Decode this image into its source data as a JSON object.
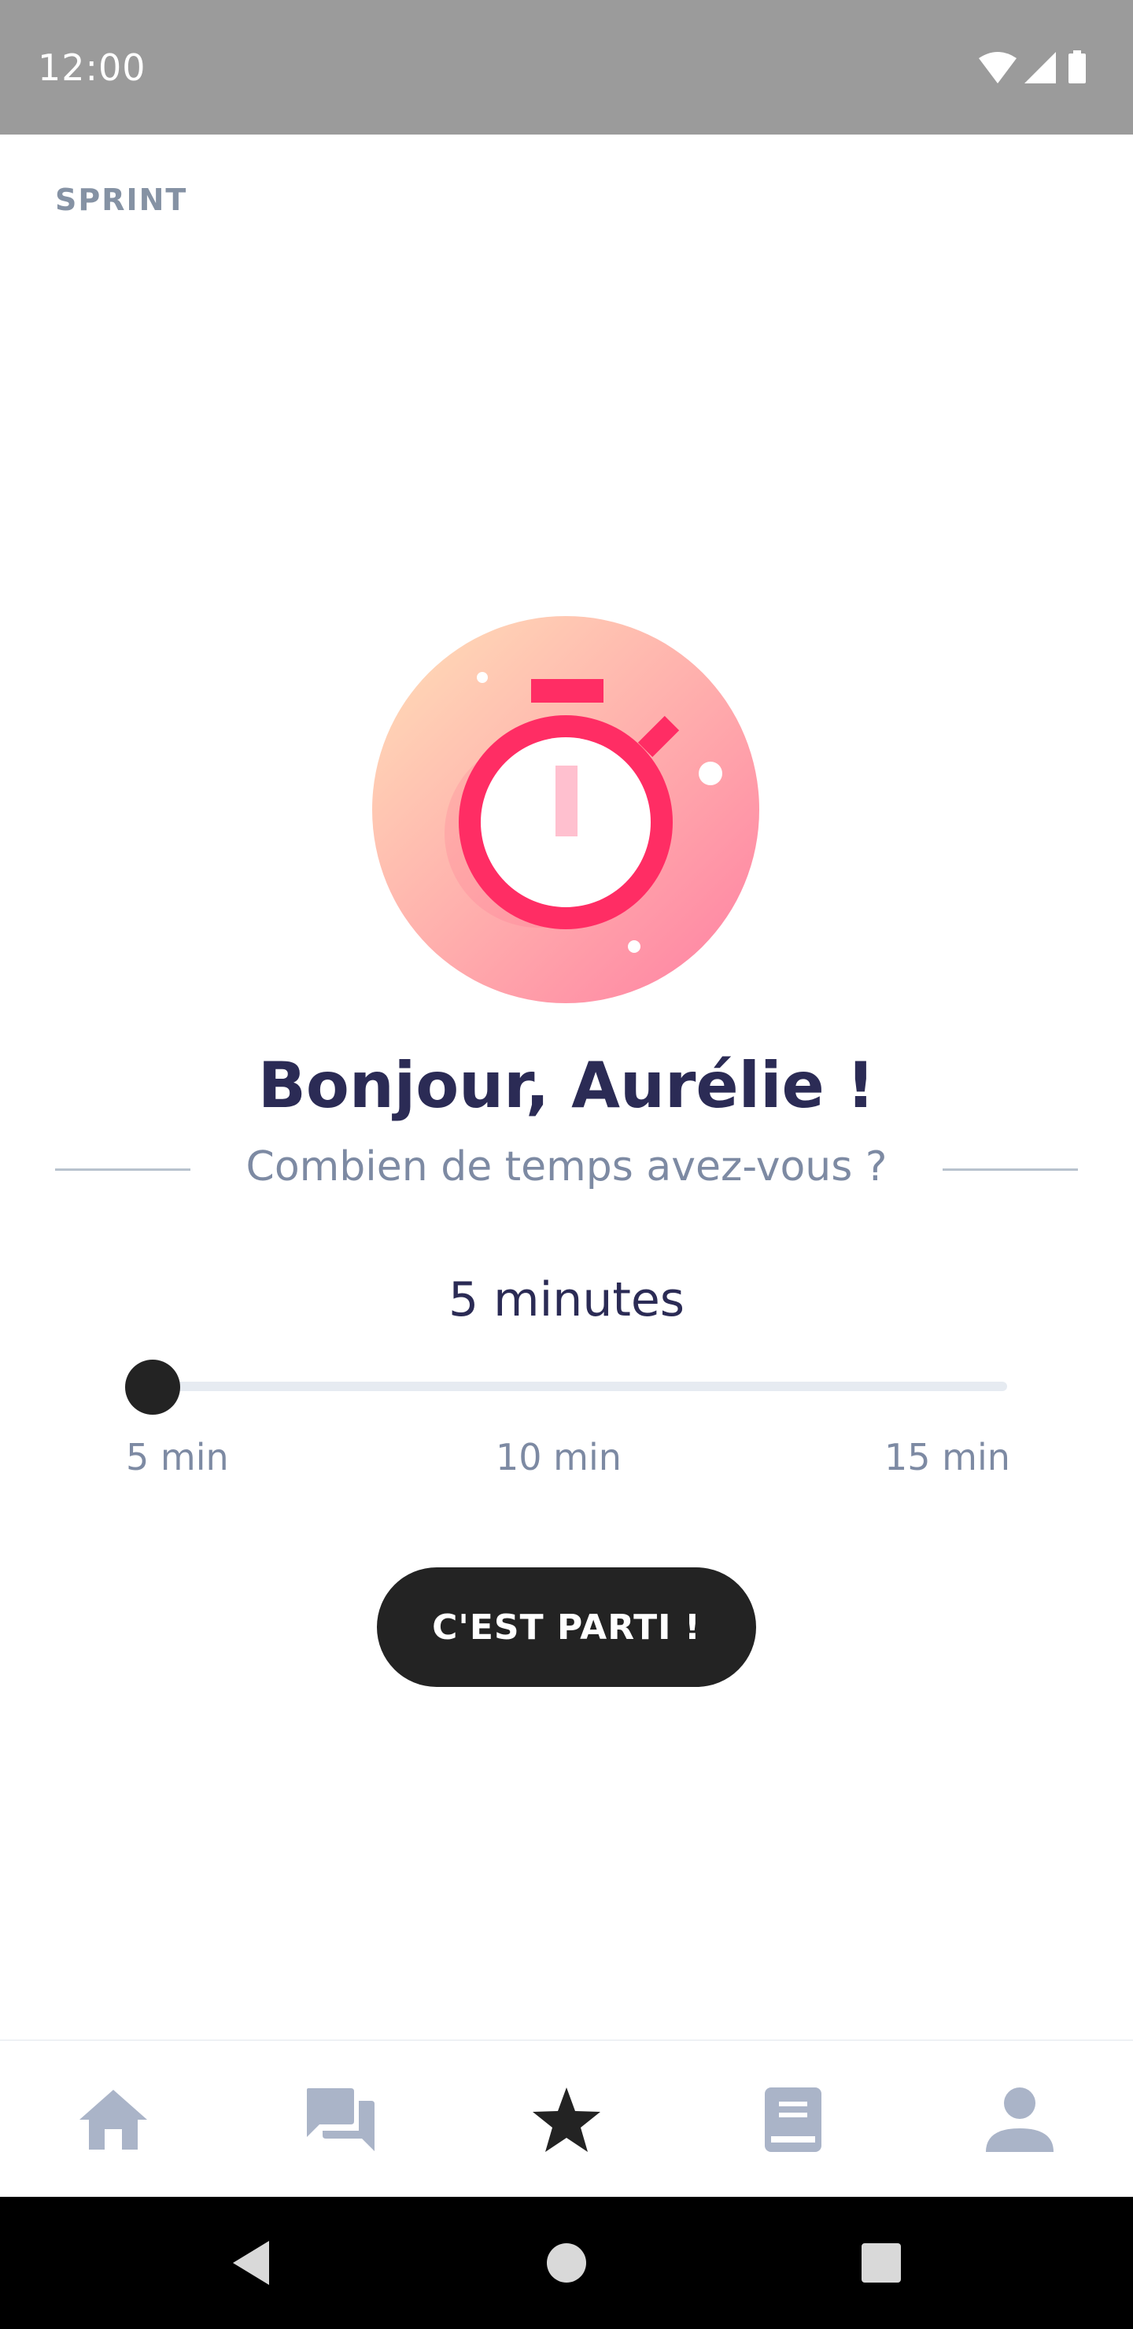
{
  "status_bar": {
    "time": "12:00",
    "icons": [
      "wifi-icon",
      "signal-icon",
      "battery-icon"
    ]
  },
  "page": {
    "label": "SPRINT"
  },
  "hero": {
    "icon": "stopwatch-icon"
  },
  "greeting": "Bonjour, Aurélie !",
  "question": "Combien de temps avez-vous ?",
  "duration": {
    "display": "5 minutes",
    "value_min": 5,
    "min": 5,
    "max": 15,
    "ticks": [
      "5 min",
      "10 min",
      "15 min"
    ]
  },
  "cta": {
    "label": "C'EST PARTI !"
  },
  "tab_bar": {
    "items": [
      {
        "icon": "home-icon",
        "active": false
      },
      {
        "icon": "chat-icon",
        "active": false
      },
      {
        "icon": "star-icon",
        "active": true
      },
      {
        "icon": "book-icon",
        "active": false
      },
      {
        "icon": "profile-icon",
        "active": false
      }
    ]
  },
  "nav_bar": {
    "icons": [
      "back-icon",
      "home-circle-icon",
      "recents-icon"
    ]
  },
  "colors": {
    "status_bar": "#9b9b9b",
    "title": "#2b2b55",
    "muted": "#7d8aa3",
    "accent": "#ff2d64",
    "button": "#232323",
    "tab_inactive": "#aab4c8",
    "tab_active": "#232323"
  }
}
